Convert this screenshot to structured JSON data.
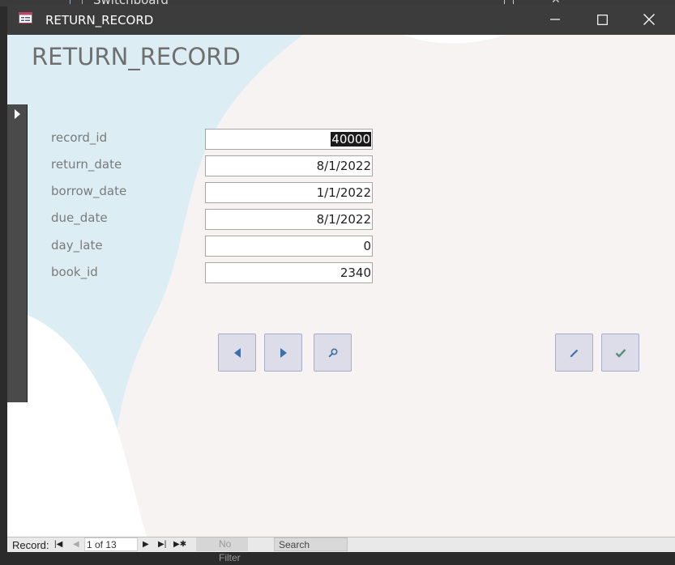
{
  "background_window": {
    "title": "Switchboard"
  },
  "window": {
    "title": "RETURN_RECORD",
    "minimize_icon": "minimize-icon",
    "maximize_icon": "maximize-icon",
    "close_icon": "close-icon"
  },
  "form": {
    "heading": "RETURN_RECORD",
    "fields": [
      {
        "label": "record_id",
        "value": "40000",
        "selected": true
      },
      {
        "label": "return_date",
        "value": "8/1/2022"
      },
      {
        "label": "borrow_date",
        "value": "1/1/2022"
      },
      {
        "label": "due_date",
        "value": "8/1/2022"
      },
      {
        "label": "day_late",
        "value": "0"
      },
      {
        "label": "book_id",
        "value": "2340"
      }
    ],
    "buttons": [
      {
        "name": "previous-record-button",
        "icon": "triangle-left-icon"
      },
      {
        "name": "next-record-button",
        "icon": "triangle-right-icon"
      },
      {
        "name": "find-record-button",
        "icon": "magnifier-icon"
      },
      {
        "name": "edit-record-button",
        "icon": "pencil-icon"
      },
      {
        "name": "save-record-button",
        "icon": "checkmark-icon"
      }
    ]
  },
  "statusbar": {
    "record_label": "Record:",
    "counter": "1 of 13",
    "filter": "No Filter",
    "search_placeholder": "Search"
  },
  "colors": {
    "title_bar": "#3c3c3c",
    "blue_wave": "#dceef4",
    "blush_wave": "#f7f3f2",
    "button_fill": "#dcdde8",
    "button_icon": "#3f6fa8",
    "check_icon": "#5a8f7a"
  }
}
